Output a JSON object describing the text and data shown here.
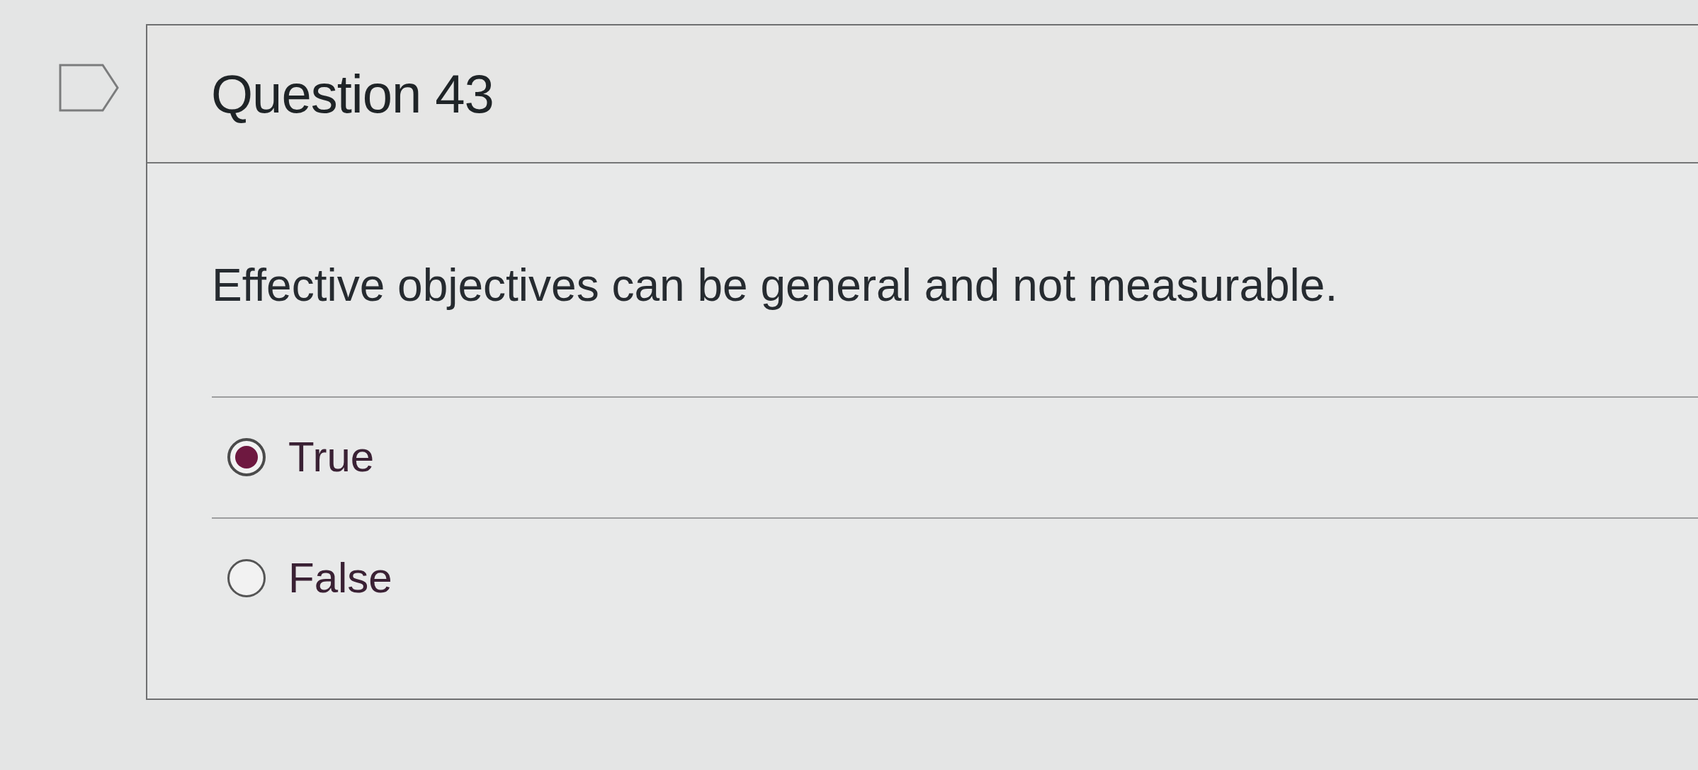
{
  "question": {
    "title": "Question 43",
    "text": "Effective objectives can be general and not measurable.",
    "answers": [
      {
        "label": "True",
        "selected": true
      },
      {
        "label": "False",
        "selected": false
      }
    ]
  }
}
